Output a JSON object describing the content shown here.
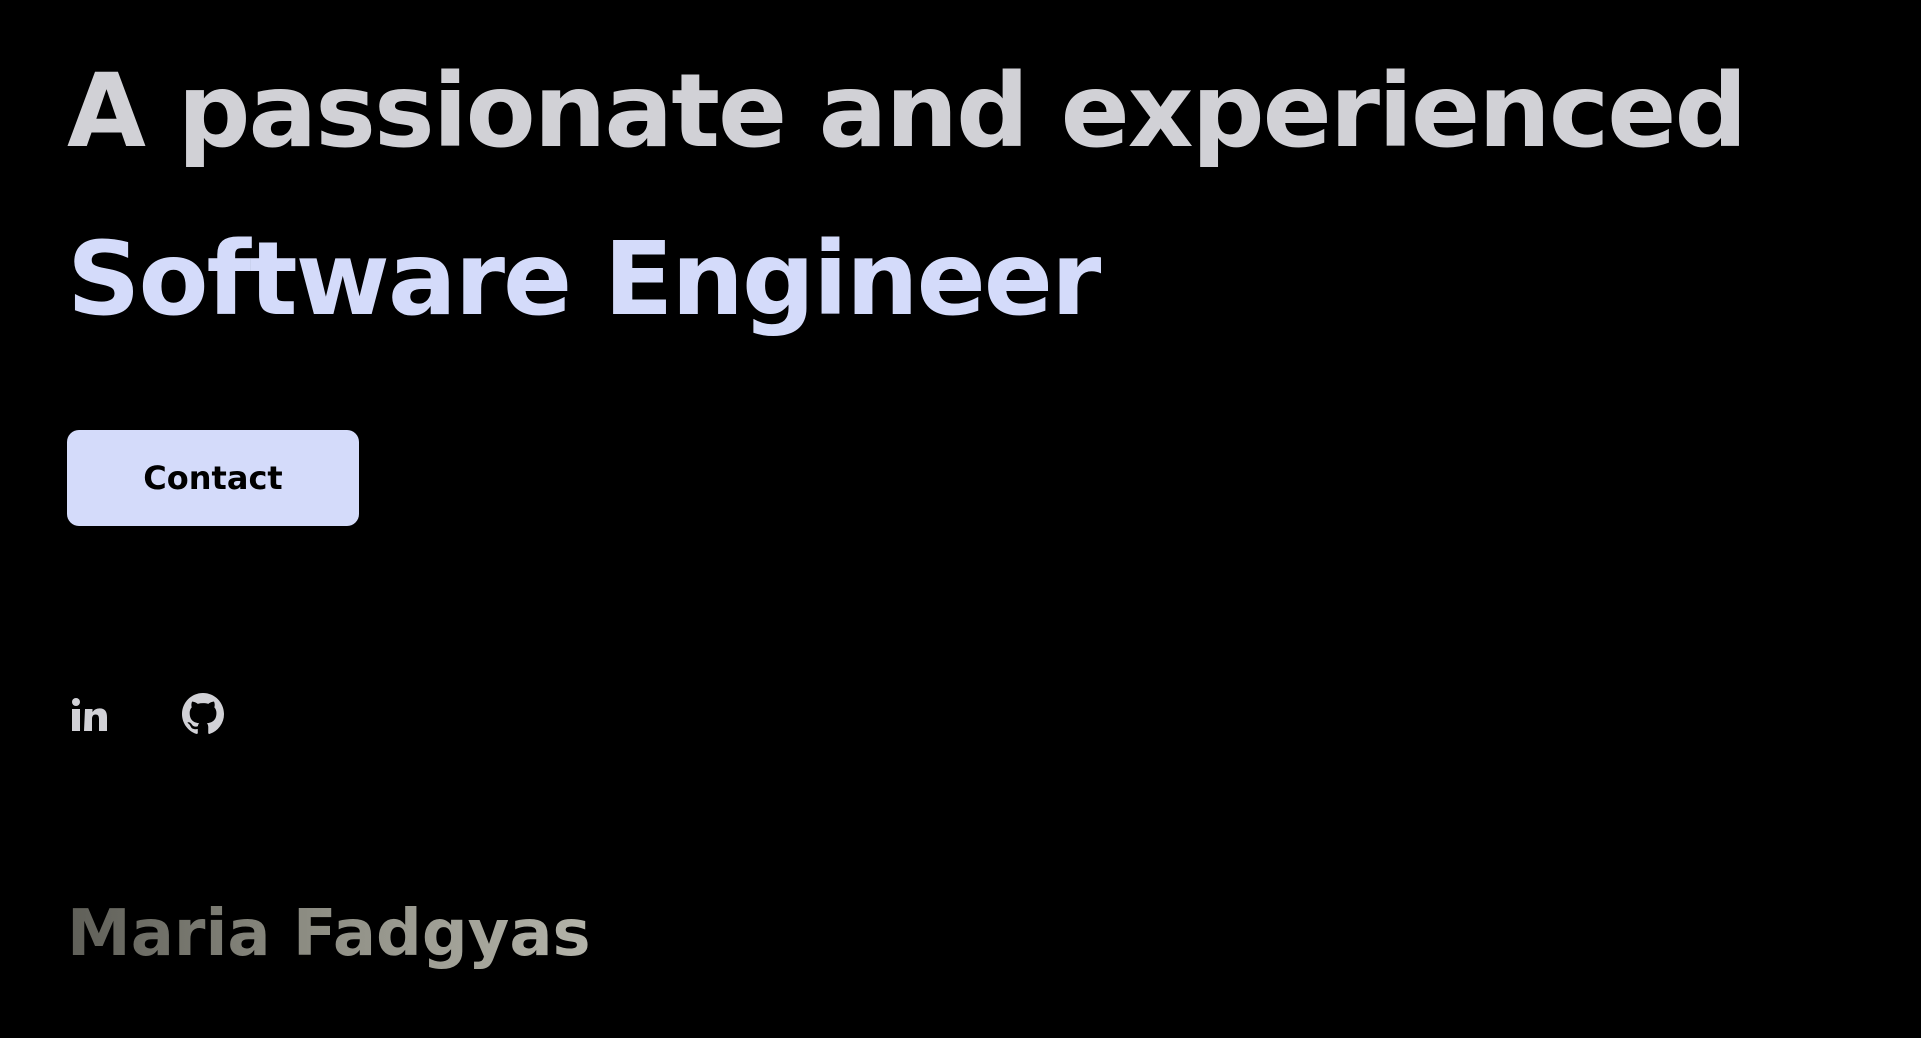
{
  "hero": {
    "headline_line1": "A passionate and experienced",
    "headline_line2": "Software Engineer"
  },
  "contact_button": {
    "label": "Contact"
  },
  "socials": [
    {
      "name": "LinkedIn",
      "icon": "linkedin-icon"
    },
    {
      "name": "GitHub",
      "icon": "github-icon"
    }
  ],
  "signature": {
    "name": "Maria Fadgyas"
  },
  "colors": {
    "background": "#000000",
    "headline": "#d1d1d6",
    "accent": "#d4dbfa",
    "button_text": "#000000",
    "signature": "#9a9a90"
  }
}
